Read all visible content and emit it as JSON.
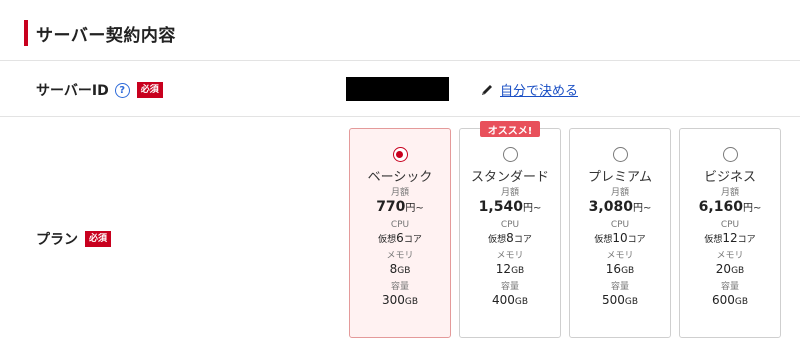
{
  "section": {
    "title": "サーバー契約内容"
  },
  "server_id": {
    "label": "サーバーID",
    "help_glyph": "?",
    "required_badge": "必須",
    "self_decide_link": "自分で決める"
  },
  "plan": {
    "label": "プラン",
    "required_badge": "必須",
    "recommend_badge": "オススメ!",
    "monthly_label": "月額",
    "cpu_label": "CPU",
    "memory_label": "メモリ",
    "storage_label": "容量",
    "cards": [
      {
        "name": "ベーシック",
        "price": "770",
        "price_unit": "円~",
        "cpu_prefix": "仮想",
        "cpu_value": "6",
        "cpu_unit": "コア",
        "memory_value": "8",
        "memory_unit": "GB",
        "storage_value": "300",
        "storage_unit": "GB",
        "selected": true
      },
      {
        "name": "スタンダード",
        "price": "1,540",
        "price_unit": "円~",
        "cpu_prefix": "仮想",
        "cpu_value": "8",
        "cpu_unit": "コア",
        "memory_value": "12",
        "memory_unit": "GB",
        "storage_value": "400",
        "storage_unit": "GB",
        "selected": false
      },
      {
        "name": "プレミアム",
        "price": "3,080",
        "price_unit": "円~",
        "cpu_prefix": "仮想",
        "cpu_value": "10",
        "cpu_unit": "コア",
        "memory_value": "16",
        "memory_unit": "GB",
        "storage_value": "500",
        "storage_unit": "GB",
        "selected": false
      },
      {
        "name": "ビジネス",
        "price": "6,160",
        "price_unit": "円~",
        "cpu_prefix": "仮想",
        "cpu_value": "12",
        "cpu_unit": "コア",
        "memory_value": "20",
        "memory_unit": "GB",
        "storage_value": "600",
        "storage_unit": "GB",
        "selected": false
      }
    ]
  },
  "colors": {
    "accent": "#c8001e",
    "link": "#1a4fc4",
    "recommend": "#e8505b",
    "selected_bg": "#fff2f2"
  }
}
